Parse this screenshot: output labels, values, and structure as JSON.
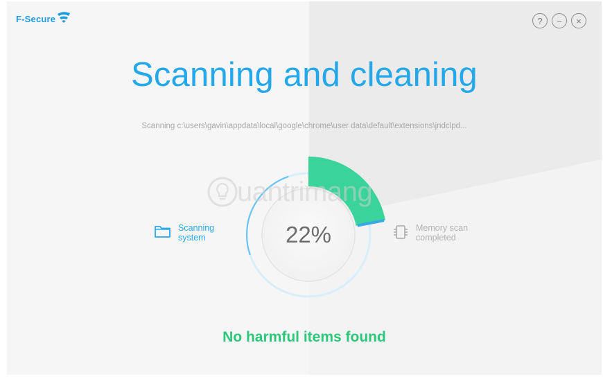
{
  "app": {
    "brand": "F-Secure",
    "brand_color": "#1f9bde"
  },
  "window_controls": {
    "help_label": "?",
    "minimize_label": "−",
    "close_label": "×"
  },
  "main": {
    "title": "Scanning and cleaning",
    "scan_path": "Scanning c:\\users\\gavin\\appdata\\local\\google\\chrome\\user data\\default\\extensions\\jndclpd...",
    "progress_text": "22%",
    "progress_value": 0.22,
    "status": "No harmful items found"
  },
  "steps": {
    "current": {
      "icon": "folder-icon",
      "line1": "Scanning",
      "line2": "system"
    },
    "done": {
      "icon": "memory-chip-icon",
      "line1": "Memory scan",
      "line2": "completed"
    }
  },
  "watermark": {
    "text": "uantrimang"
  },
  "colors": {
    "title": "#24a8ea",
    "status": "#2cc77a",
    "progress_arc": "#3ad49a"
  }
}
